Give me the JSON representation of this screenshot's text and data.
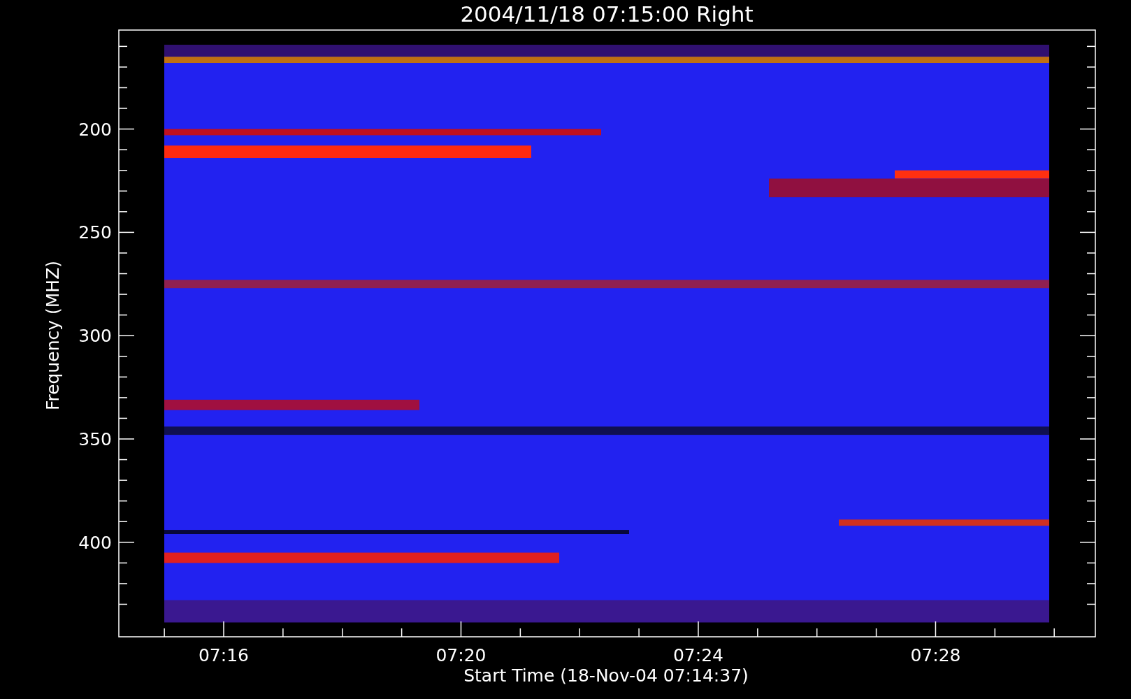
{
  "title": "2004/11/18 07:15:00 Right",
  "y_axis": {
    "label": "Frequency (MHZ)",
    "ticks": [
      "200",
      "250",
      "300",
      "350",
      "400"
    ]
  },
  "x_axis": {
    "label": "Start Time (18-Nov-04 07:14:37)",
    "ticks": [
      "07:16",
      "07:20",
      "07:24",
      "07:28"
    ]
  }
}
